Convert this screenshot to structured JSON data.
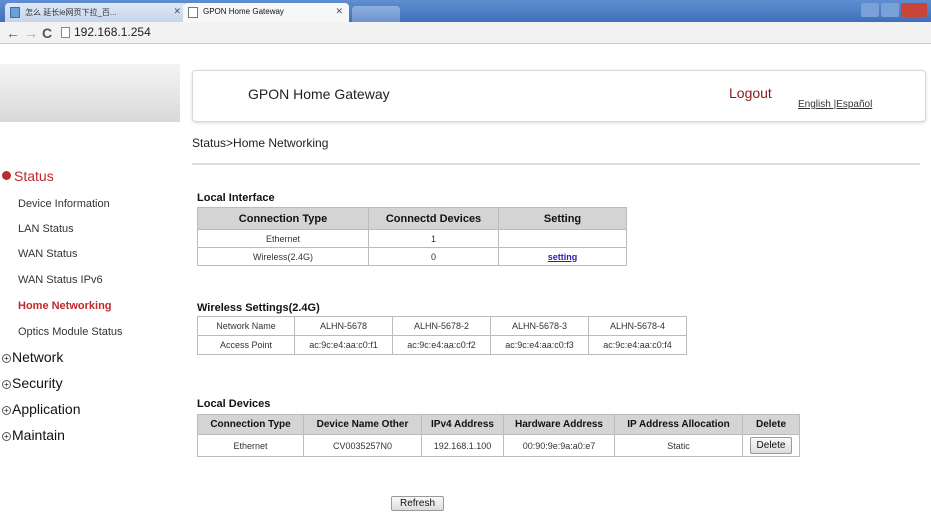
{
  "browser": {
    "tabs": [
      {
        "title": "怎么 延长ie网页下拉_百..."
      },
      {
        "title": "GPON Home Gateway"
      }
    ],
    "url": "192.168.1.254"
  },
  "header": {
    "title": "GPON Home Gateway",
    "logout": "Logout",
    "languages": "English |Español"
  },
  "breadcrumb": "Status>Home Networking",
  "sidebar": {
    "status_label": "Status",
    "status_items": [
      {
        "label": "Device Information"
      },
      {
        "label": "LAN Status"
      },
      {
        "label": "WAN Status"
      },
      {
        "label": "WAN Status IPv6"
      },
      {
        "label": "Home Networking"
      },
      {
        "label": "Optics Module Status"
      }
    ],
    "sections": [
      {
        "label": "Network"
      },
      {
        "label": "Security"
      },
      {
        "label": "Application"
      },
      {
        "label": "Maintain"
      }
    ]
  },
  "local_interface": {
    "title": "Local Interface",
    "headers": [
      "Connection Type",
      "Connectd Devices",
      "Setting"
    ],
    "rows": [
      {
        "type": "Ethernet",
        "devices": "1",
        "setting": ""
      },
      {
        "type": "Wireless(2.4G)",
        "devices": "0",
        "setting": "setting"
      }
    ]
  },
  "wireless_settings": {
    "title": "Wireless Settings(2.4G)",
    "row1_label": "Network Name",
    "networks": [
      "ALHN-5678",
      "ALHN-5678-2",
      "ALHN-5678-3",
      "ALHN-5678-4"
    ],
    "row2_label": "Access Point",
    "access_points": [
      "ac:9c:e4:aa:c0:f1",
      "ac:9c:e4:aa:c0:f2",
      "ac:9c:e4:aa:c0:f3",
      "ac:9c:e4:aa:c0:f4"
    ]
  },
  "local_devices": {
    "title": "Local Devices",
    "headers": [
      "Connection Type",
      "Device Name Other",
      "IPv4 Address",
      "Hardware Address",
      "IP Address Allocation",
      "Delete"
    ],
    "rows": [
      {
        "type": "Ethernet",
        "name": "CV0035257N0",
        "ipv4": "192.168.1.100",
        "mac": "00:90:9e:9a:a0:e7",
        "allocation": "Static",
        "delete": "Delete"
      }
    ]
  },
  "refresh_label": "Refresh"
}
